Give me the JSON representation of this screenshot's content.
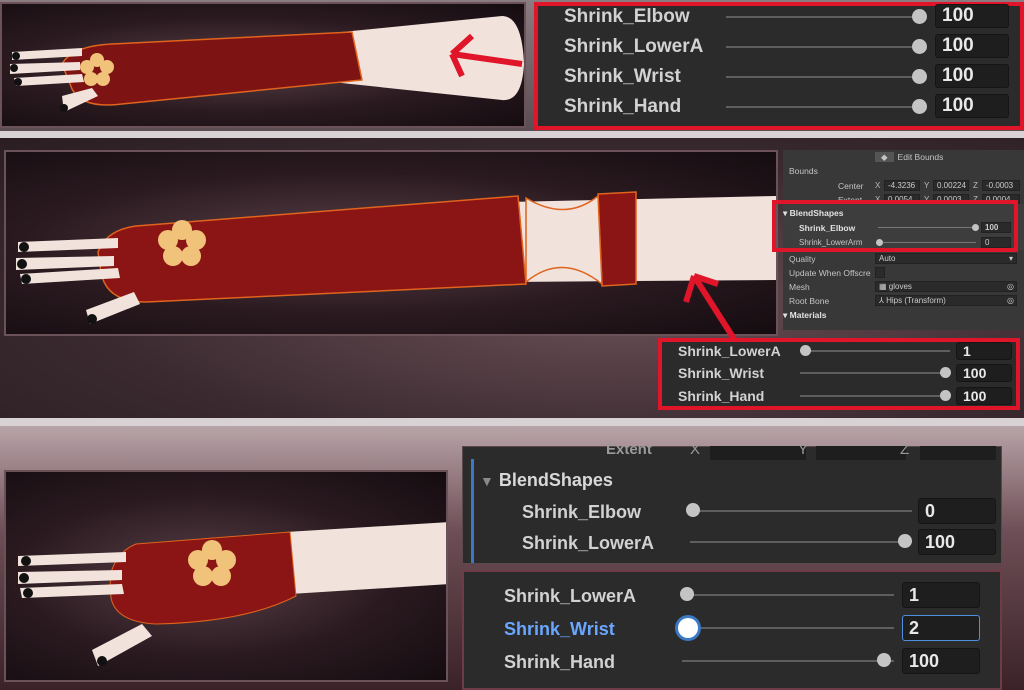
{
  "panel_top": {
    "rows": [
      {
        "label": "Shrink_Elbow",
        "value": "100",
        "slider": 1.0
      },
      {
        "label": "Shrink_LowerA",
        "value": "100",
        "slider": 1.0
      },
      {
        "label": "Shrink_Wrist",
        "value": "100",
        "slider": 1.0
      },
      {
        "label": "Shrink_Hand",
        "value": "100",
        "slider": 1.0
      }
    ]
  },
  "inspector": {
    "edit_bounds": "Edit Bounds",
    "bounds": "Bounds",
    "center": "Center",
    "extent": "Extent",
    "center_x": "-4.3236",
    "center_y": "0.00224",
    "center_z": "-0.0003",
    "extent_x": "0.0054",
    "extent_y": "0.0003",
    "extent_z": "0.0004",
    "axis_x": "X",
    "axis_y": "Y",
    "axis_z": "Z",
    "blendshapes_header": "BlendShapes",
    "shrink_elbow_label": "Shrink_Elbow",
    "shrink_elbow_value": "100",
    "shrink_lowerarm_label": "Shrink_LowerArm",
    "shrink_lowerarm_value": "0",
    "quality_label": "Quality",
    "quality_value": "Auto",
    "update_offscreen_label": "Update When Offscre",
    "mesh_label": "Mesh",
    "mesh_value": "gloves",
    "root_bone_label": "Root Bone",
    "root_bone_value": "Hips (Transform)",
    "materials_header": "Materials"
  },
  "panel_mid": {
    "rows": [
      {
        "label": "Shrink_LowerA",
        "value": "1",
        "slider": 0.01
      },
      {
        "label": "Shrink_Wrist",
        "value": "100",
        "slider": 1.0
      },
      {
        "label": "Shrink_Hand",
        "value": "100",
        "slider": 1.0
      }
    ]
  },
  "panel_bottom_a": {
    "extent_label": "Extent",
    "axis_x": "X",
    "axis_y": "Y",
    "axis_z": "Z",
    "blendshapes_header": "BlendShapes",
    "rows": [
      {
        "label": "Shrink_Elbow",
        "value": "0",
        "slider": 0.0
      },
      {
        "label": "Shrink_LowerA",
        "value": "100",
        "slider": 1.0
      }
    ]
  },
  "panel_bottom_b": {
    "rows": [
      {
        "label": "Shrink_LowerA",
        "value": "1",
        "slider": 0.01
      },
      {
        "label": "Shrink_Wrist",
        "value": "2",
        "slider": 0.02,
        "focused": true
      },
      {
        "label": "Shrink_Hand",
        "value": "100",
        "slider": 1.0
      }
    ]
  },
  "colors": {
    "highlight": "#e0152a",
    "focus_label": "#6aa6ff",
    "glove": "#8b1414",
    "skin": "#f2e2dc"
  }
}
